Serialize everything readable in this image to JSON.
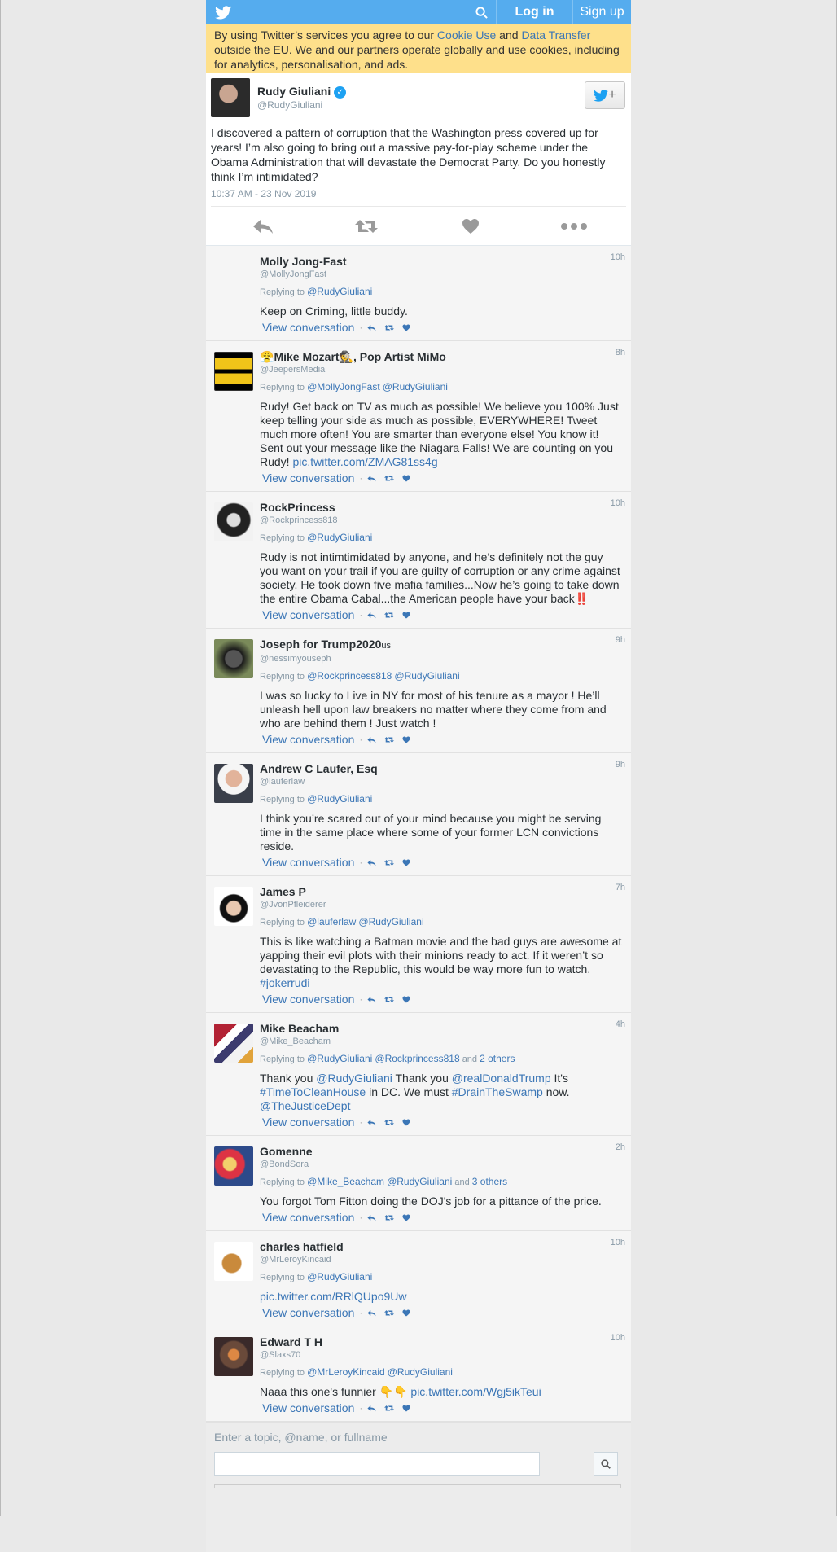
{
  "topbar": {
    "login": "Log in",
    "signup": "Sign up"
  },
  "cookie": {
    "part1": "By using Twitter’s services you agree to our ",
    "link1": "Cookie Use",
    "part2": " and ",
    "link2": "Data Transfer",
    "part3": " outside the EU. We and our partners operate globally and use cookies, including for analytics, personalisation, and ads."
  },
  "tweet": {
    "name": "Rudy Giuliani",
    "handle": "@RudyGiuliani",
    "text": "I discovered a pattern of corruption that the Washington press covered up for years! I’m also going to bring out a massive pay-for-play scheme under the Obama Administration that will devastate the Democrat Party. Do you honestly think I’m intimidated?",
    "time": "10:37 AM - 23 Nov 2019"
  },
  "replying_label": "Replying to",
  "view_conversation": "View conversation",
  "replies": [
    {
      "name": "Molly Jong-Fast",
      "handle": "@MollyJongFast",
      "time": "10h",
      "to": [
        "@RudyGiuliani"
      ],
      "others": "",
      "text": "Keep on Criming, little buddy.",
      "link": ""
    },
    {
      "name": "Mike Mozart",
      "name_suffix": ", Pop Artist MiMo",
      "handle": "@JeepersMedia",
      "time": "8h",
      "to": [
        "@MollyJongFast",
        "@RudyGiuliani"
      ],
      "others": "",
      "text": "Rudy! Get back on TV as much as possible! We believe you 100% Just keep telling your side as much as possible, EVERYWHERE! Tweet much more often! You are smarter than everyone else! You know it! Sent out your message like the Niagara Falls! We are counting on you Rudy! ",
      "link": "pic.twitter.com/ZMAG81ss4g"
    },
    {
      "name": "RockPrincess",
      "handle": "@Rockprincess818",
      "time": "10h",
      "to": [
        "@RudyGiuliani"
      ],
      "others": "",
      "text": "Rudy is not intimtimidated by anyone, and he’s definitely not the guy you want on your trail if you are guilty of corruption or any crime against society. He took down five mafia families...Now he’s going to take down the entire Obama Cabal...the American people have your back‼️",
      "link": ""
    },
    {
      "name": "Joseph for Trump2020",
      "name_suffix": "us",
      "handle": "@nessimyouseph",
      "time": "9h",
      "to": [
        "@Rockprincess818",
        "@RudyGiuliani"
      ],
      "others": "",
      "text": "I was so lucky to Live in NY for most of his tenure as a mayor ! He’ll unleash hell upon law breakers no matter where they come from and who are behind them ! Just watch !",
      "link": ""
    },
    {
      "name": "Andrew C Laufer, Esq",
      "handle": "@lauferlaw",
      "time": "9h",
      "to": [
        "@RudyGiuliani"
      ],
      "others": "",
      "text": "I think you’re scared out of your mind because you might be serving time in the same place where some of your former LCN convictions reside.",
      "link": ""
    },
    {
      "name": "James P",
      "handle": "@JvonPfleiderer",
      "time": "7h",
      "to": [
        "@lauferlaw",
        "@RudyGiuliani"
      ],
      "others": "",
      "text": "This is like watching a Batman movie and the bad guys are awesome at yapping their evil plots with their minions ready to act. If it weren’t so devastating to the Republic, this would be way more fun to watch. ",
      "link": "#jokerrudi"
    },
    {
      "name": "Mike Beacham",
      "handle": "@Mike_Beacham",
      "time": "4h",
      "to": [
        "@RudyGiuliani",
        "@Rockprincess818"
      ],
      "others": "2 others",
      "others_and": "and",
      "text": "",
      "link": ""
    },
    {
      "name": "Gomenne",
      "handle": "@BondSora",
      "time": "2h",
      "to": [
        "@Mike_Beacham",
        "@RudyGiuliani"
      ],
      "others": "3 others",
      "others_and": "and",
      "text": "You forgot Tom Fitton doing the DOJ's job for a pittance of the price.",
      "link": ""
    },
    {
      "name": "charles hatfield",
      "handle": "@MrLeroyKincaid",
      "time": "10h",
      "to": [
        "@RudyGiuliani"
      ],
      "others": "",
      "text": "",
      "link": "pic.twitter.com/RRlQUpo9Uw"
    },
    {
      "name": "Edward T H",
      "handle": "@Slaxs70",
      "time": "10h",
      "to": [
        "@MrLeroyKincaid",
        "@RudyGiuliani"
      ],
      "others": "",
      "text": "Naaa this one's funnier 👇👇 ",
      "link": "pic.twitter.com/Wgj5ikTeui"
    }
  ],
  "beacham": {
    "t1": "Thank you ",
    "l1": "@RudyGiuliani",
    "t2": " Thank you ",
    "l2": "@realDonaldTrump",
    "t3": " It's ",
    "l3": "#TimeToCleanHouse",
    "t4": " in DC. We must ",
    "l4": "#DrainTheSwamp",
    "t5": " now. ",
    "l5": "@TheJusticeDept"
  },
  "search": {
    "placeholder": "Enter a topic, @name, or fullname"
  },
  "colors": {
    "accent": "#55acee",
    "link": "#3b76b6",
    "cookie_bg": "#fee08b"
  }
}
